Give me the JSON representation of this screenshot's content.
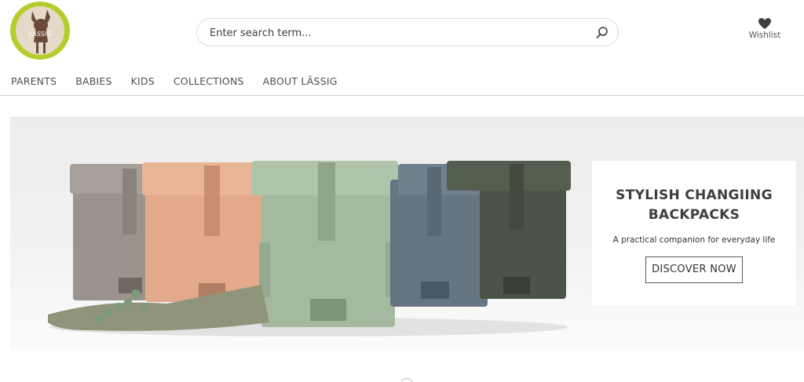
{
  "header": {
    "logo_icon": "lassig-fawn-logo",
    "logo_text": "LÄSSIG",
    "search": {
      "placeholder": "Enter search term...",
      "value": "",
      "icon": "search-icon"
    },
    "wishlist": {
      "label": "Wishlist",
      "icon": "heart-icon"
    }
  },
  "nav": {
    "items": [
      {
        "label": "PARENTS"
      },
      {
        "label": "BABIES"
      },
      {
        "label": "KIDS"
      },
      {
        "label": "COLLECTIONS"
      },
      {
        "label": "ABOUT LÄSSIG"
      }
    ]
  },
  "hero": {
    "image": "changing-backpacks-lineup",
    "backpack_colors": [
      "#9c948c",
      "#e2a98a",
      "#a4b99f",
      "#657583",
      "#4b5446"
    ],
    "promo": {
      "title": "STYLISH CHANGIING BACKPACKS",
      "subtitle": "A practical companion for everyday life",
      "button_label": "DISCOVER NOW"
    }
  },
  "colors": {
    "logo_green": "#b6cc2b",
    "text": "#4a4a4a",
    "divider": "#cfcfcf"
  }
}
